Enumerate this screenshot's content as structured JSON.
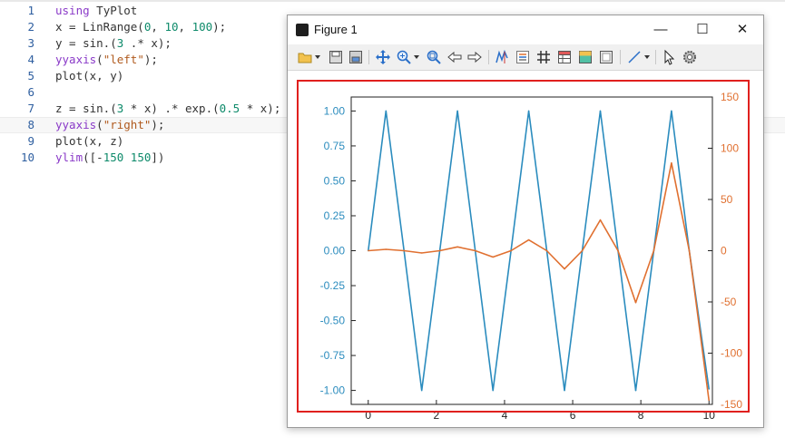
{
  "editor": {
    "lines": [
      {
        "no": "1",
        "text": "using TyPlot"
      },
      {
        "no": "2",
        "text": "x = LinRange(0, 10, 100);"
      },
      {
        "no": "3",
        "text": "y = sin.(3 .* x);"
      },
      {
        "no": "4",
        "text": "yyaxis(\"left\");"
      },
      {
        "no": "5",
        "text": "plot(x, y)"
      },
      {
        "no": "6",
        "text": ""
      },
      {
        "no": "7",
        "text": "z = sin.(3 * x) .* exp.(0.5 * x);"
      },
      {
        "no": "8",
        "text": "yyaxis(\"right\");"
      },
      {
        "no": "9",
        "text": "plot(x, z)"
      },
      {
        "no": "10",
        "text": "ylim([-150 150])"
      }
    ],
    "current_line": 8
  },
  "figure": {
    "title": "Figure 1",
    "minimize": "—",
    "maximize": "☐",
    "close": "✕",
    "toolbar_icons": [
      "open-folder-icon",
      "save-icon",
      "save-as-icon",
      "pan-icon",
      "zoom-in-icon",
      "zoom-fit-icon",
      "back-icon",
      "forward-icon",
      "data-cursor-icon",
      "legend-icon",
      "grid-icon",
      "table-icon",
      "colorbar-icon",
      "frame-icon",
      "line-tool-icon",
      "pointer-icon",
      "settings-icon"
    ],
    "highlight_color": "#e0201e"
  },
  "chart_data": {
    "type": "line",
    "title": "",
    "xlabel": "",
    "xlim": [
      -0.5,
      10.1
    ],
    "xticks": [
      0,
      2,
      4,
      6,
      8,
      10
    ],
    "left_axis": {
      "ylim": [
        -1.1,
        1.1
      ],
      "yticks": [
        1.0,
        0.75,
        0.5,
        0.25,
        0.0,
        -0.25,
        -0.5,
        -0.75,
        -1.0
      ],
      "ytick_labels": [
        "1.00",
        "0.75",
        "0.50",
        "0.25",
        "0.00",
        "-0.25",
        "-0.50",
        "-0.75",
        "-1.00"
      ],
      "color": "#2b8cbe"
    },
    "right_axis": {
      "ylim": [
        -150,
        150
      ],
      "yticks": [
        150,
        100,
        50,
        0,
        -50,
        -100,
        -150
      ],
      "ytick_labels": [
        "150",
        "100",
        "50",
        "0",
        "-50",
        "-100",
        "-150"
      ],
      "color": "#e07030"
    },
    "series": [
      {
        "axis": "left",
        "color": "#2b8cbe",
        "x": [
          0.0,
          0.52,
          1.05,
          1.57,
          2.1,
          2.62,
          3.14,
          3.66,
          4.19,
          4.71,
          5.24,
          5.76,
          6.28,
          6.81,
          7.33,
          7.85,
          8.38,
          8.9,
          9.42,
          10.0
        ],
        "y": [
          0.0,
          1.0,
          0.0,
          -1.0,
          0.0,
          1.0,
          0.0,
          -1.0,
          0.0,
          1.0,
          0.0,
          -1.0,
          0.0,
          1.0,
          0.0,
          -1.0,
          0.0,
          1.0,
          0.0,
          -0.99
        ]
      },
      {
        "axis": "right",
        "color": "#e07030",
        "x": [
          0.0,
          0.52,
          1.05,
          1.57,
          2.1,
          2.62,
          3.14,
          3.66,
          4.19,
          4.71,
          5.24,
          5.76,
          6.28,
          6.81,
          7.33,
          7.85,
          8.38,
          8.9,
          9.42,
          10.0
        ],
        "y": [
          0.0,
          1.3,
          0.0,
          -2.2,
          0.0,
          3.7,
          0.0,
          -6.2,
          0.0,
          10.5,
          0.0,
          -17.8,
          0.0,
          30.0,
          0.0,
          -50.7,
          0.0,
          85.6,
          0.0,
          -146.0
        ]
      }
    ]
  }
}
